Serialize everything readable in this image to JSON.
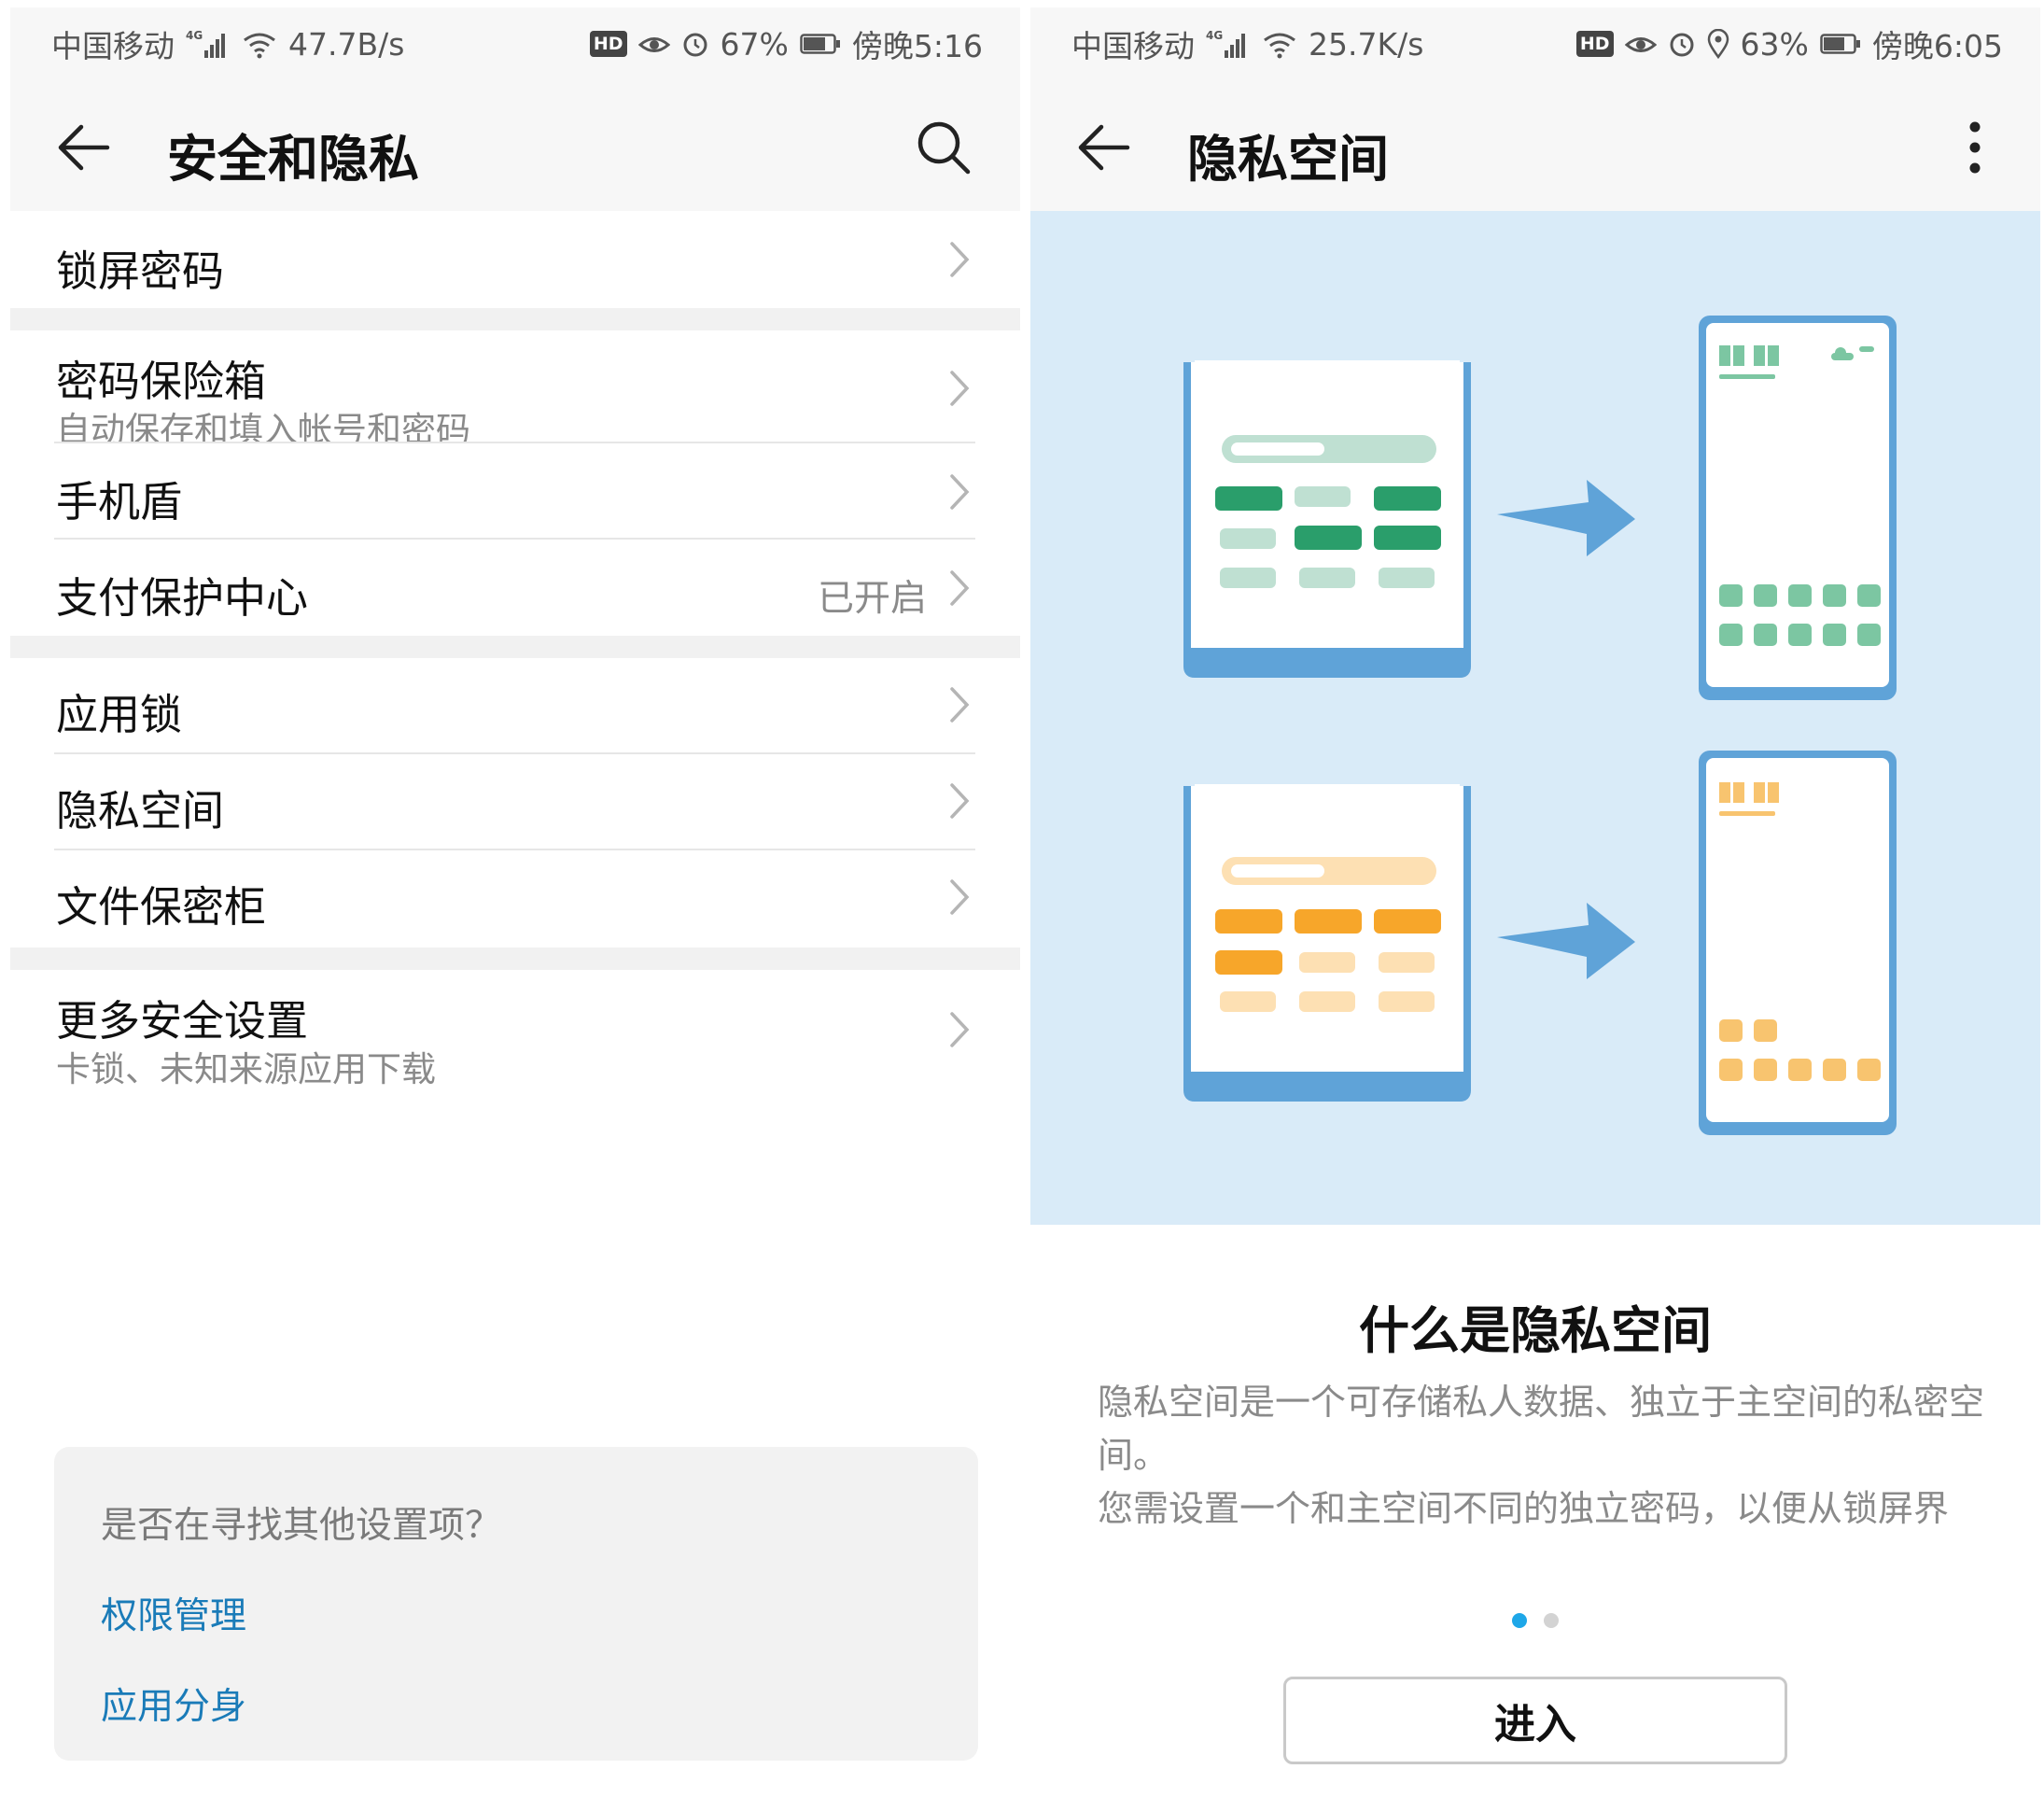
{
  "left": {
    "status": {
      "carrier": "中国移动",
      "network": "4G",
      "speed": "47.7B/s",
      "hd": "HD",
      "battery": "67%",
      "time": "傍晚5:16"
    },
    "title": "安全和隐私",
    "rows": [
      {
        "label": "锁屏密码"
      },
      {
        "label": "密码保险箱",
        "subtitle": "自动保存和填入帐号和密码"
      },
      {
        "label": "手机盾"
      },
      {
        "label": "支付保护中心",
        "state": "已开启"
      },
      {
        "label": "应用锁"
      },
      {
        "label": "隐私空间"
      },
      {
        "label": "文件保密柜"
      },
      {
        "label": "更多安全设置",
        "subtitle": "卡锁、未知来源应用下载"
      }
    ],
    "suggest": {
      "question": "是否在寻找其他设置项？",
      "links": [
        "权限管理",
        "应用分身"
      ]
    }
  },
  "right": {
    "status": {
      "carrier": "中国移动",
      "network": "4G",
      "speed": "25.7K/s",
      "hd": "HD",
      "battery": "63%",
      "time": "傍晚6:05"
    },
    "title": "隐私空间",
    "heading": "什么是隐私空间",
    "desc_line1": "隐私空间是一个可存储私人数据、独立于主空间的私密空间。",
    "desc_line2": "您需设置一个和主空间不同的独立密码，以便从锁屏界",
    "pager": {
      "current": 1,
      "total": 2
    },
    "enter_button": "进入"
  },
  "colors": {
    "green_dark": "#2a9e6b",
    "green_light": "#bfe0d2",
    "green_mid": "#7cc6a2",
    "orange_dark": "#f7a62a",
    "orange_light": "#fde0b3",
    "orange_mid": "#f8c46f",
    "phone_blue": "#5fa3d8",
    "illus_bg": "#d9ebf8",
    "link": "#1a7bb8",
    "pager_active": "#1ea7e8"
  },
  "icons": [
    "back-arrow-icon",
    "search-icon",
    "more-vertical-icon",
    "chevron-right-icon",
    "signal-icon",
    "wifi-icon",
    "eye-icon",
    "alarm-icon",
    "location-icon",
    "battery-icon"
  ]
}
